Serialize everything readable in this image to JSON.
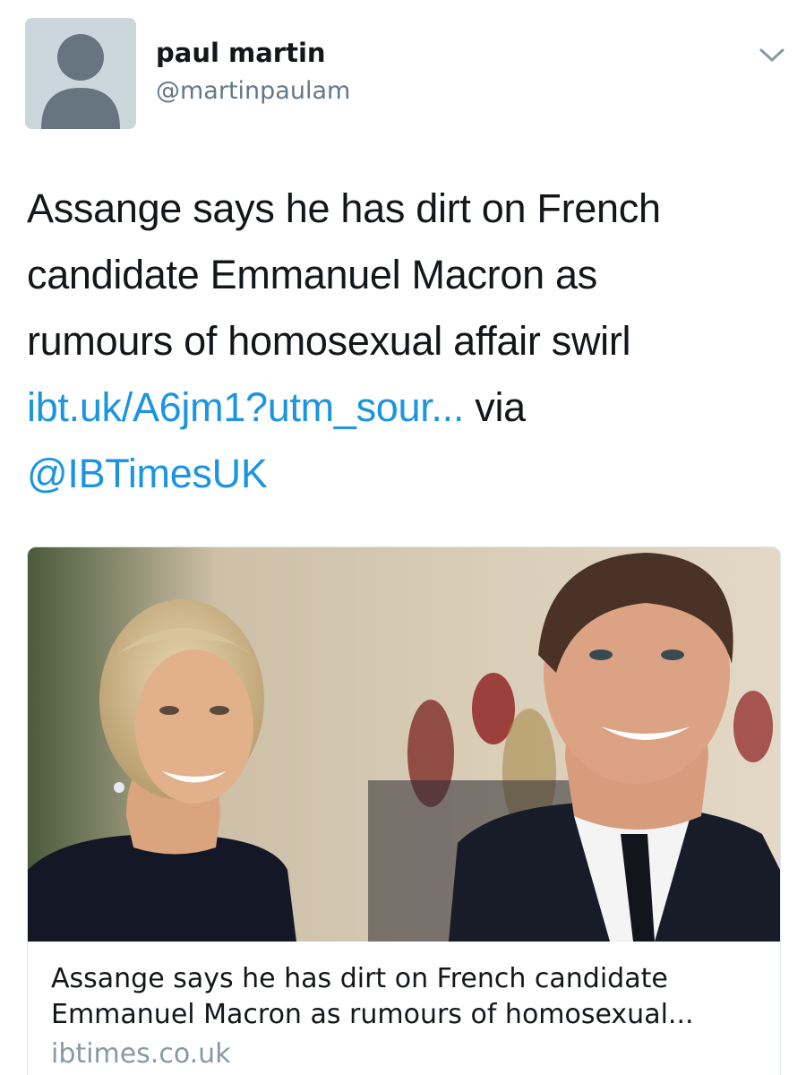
{
  "user": {
    "display_name": "paul martin",
    "handle": "@martinpaulam",
    "avatar_icon": "default-avatar-icon"
  },
  "menu": {
    "icon": "chevron-down-icon"
  },
  "tweet": {
    "line1": "Assange says he has dirt on French",
    "line2": "candidate Emmanuel Macron as",
    "line3": "rumours of homosexual affair swirl",
    "link": "ibt.uk/A6jm1?utm_sour...",
    "via": " via",
    "mention": "@IBTimesUK"
  },
  "card": {
    "title_line1": "Assange says he has dirt on French candidate",
    "title_line2": "Emmanuel Macron as rumours of homosexual...",
    "domain": "ibtimes.co.uk"
  },
  "colors": {
    "link": "#1b95e0",
    "text": "#14171a",
    "secondary": "#657786",
    "avatar_bg": "#ccd6dd"
  }
}
